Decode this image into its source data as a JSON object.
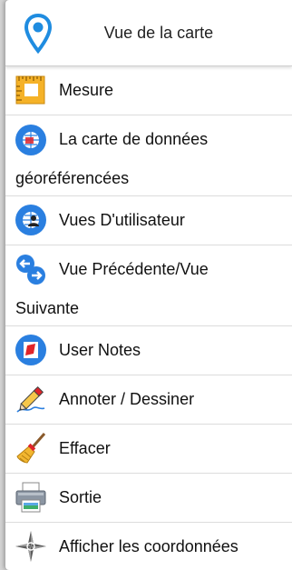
{
  "header": {
    "title": "Vue de la carte",
    "icon": "map-pin-icon"
  },
  "items": [
    {
      "id": "mesure",
      "icon": "ruler-icon",
      "line1": "Mesure",
      "line2": ""
    },
    {
      "id": "carte-donnees",
      "icon": "globe-map-icon",
      "line1": "La carte de données",
      "line2": "géoréférencées"
    },
    {
      "id": "vues-utilisateur",
      "icon": "globe-user-icon",
      "line1": "Vues D'utilisateur",
      "line2": ""
    },
    {
      "id": "vue-precedente",
      "icon": "prev-next-arrows-icon",
      "line1": "Vue Précédente/Vue",
      "line2": "Suivante"
    },
    {
      "id": "user-notes",
      "icon": "note-icon",
      "line1": "User Notes",
      "line2": ""
    },
    {
      "id": "annoter",
      "icon": "pencil-icon",
      "line1": "Annoter / Dessiner",
      "line2": ""
    },
    {
      "id": "effacer",
      "icon": "broom-icon",
      "line1": "Effacer",
      "line2": ""
    },
    {
      "id": "sortie",
      "icon": "printer-icon",
      "line1": "Sortie",
      "line2": ""
    },
    {
      "id": "coordonnees",
      "icon": "compass-icon",
      "line1": "Afficher les coordonnées",
      "line2": ""
    }
  ],
  "colors": {
    "pin": "#1f8ce0",
    "icon_blue": "#2a7fe0",
    "ruler": "#f5b228",
    "note_red": "#e0242a"
  }
}
